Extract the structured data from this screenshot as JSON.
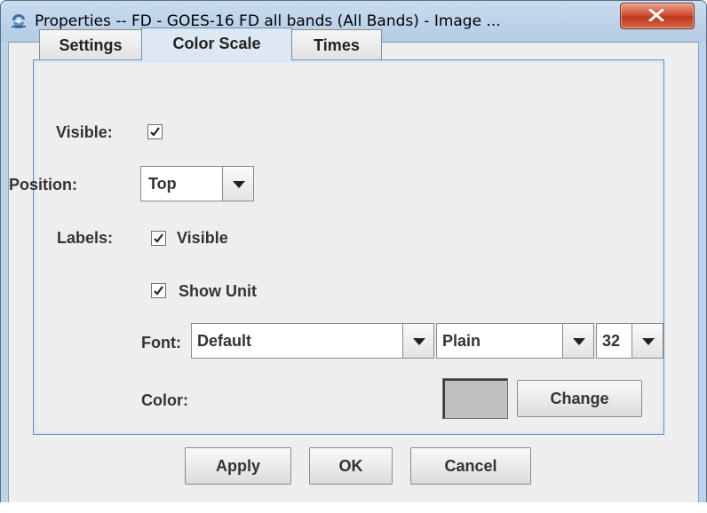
{
  "window": {
    "title": "Properties -- FD - GOES-16 FD all bands (All Bands) - Image ...",
    "icon": "idv-app-icon",
    "close_icon": "close-icon"
  },
  "tabs": [
    {
      "label": "Settings",
      "selected": false
    },
    {
      "label": "Color Scale",
      "selected": true
    },
    {
      "label": "Times",
      "selected": false
    }
  ],
  "form": {
    "visible": {
      "label": "Visible:",
      "checked": true
    },
    "position": {
      "label": "Position:",
      "value": "Top"
    },
    "labels": {
      "label": "Labels:",
      "visible": {
        "label": "Visible",
        "checked": true
      },
      "show_unit": {
        "label": "Show Unit",
        "checked": true
      }
    },
    "font": {
      "label": "Font:",
      "family": "Default",
      "style": "Plain",
      "size": "32"
    },
    "color": {
      "label": "Color:",
      "swatch": "#c0c0c0",
      "change_label": "Change"
    }
  },
  "buttons": {
    "apply": "Apply",
    "ok": "OK",
    "cancel": "Cancel"
  },
  "colors": {
    "title_bar": "#bcd4ea",
    "close_button": "#c8442a",
    "selected_tab": "#dde8f3"
  }
}
